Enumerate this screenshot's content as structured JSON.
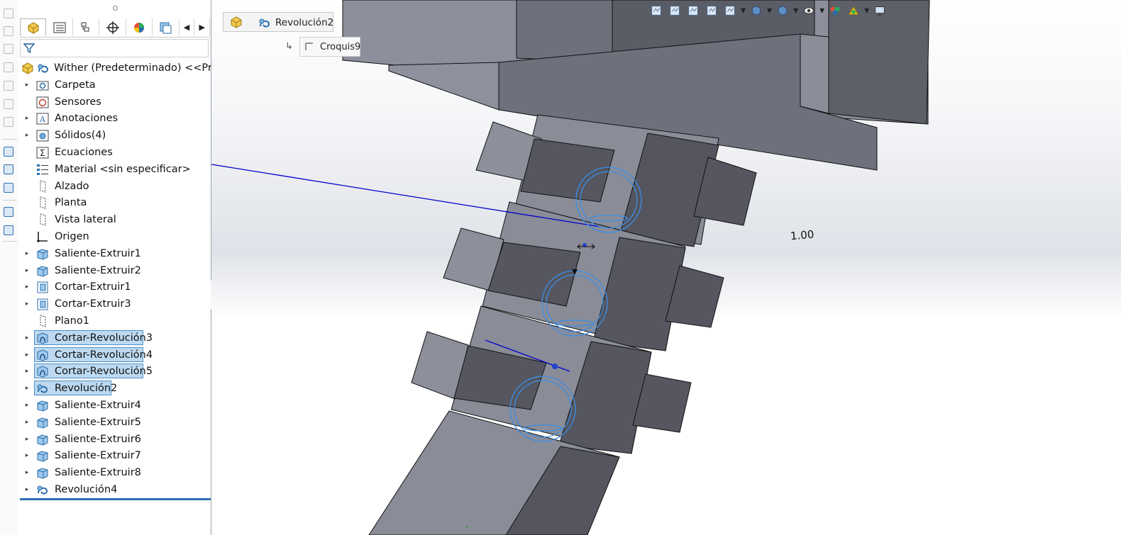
{
  "command_strip": {
    "icons": [
      "sketch-mode-icon",
      "sketch-mode-icon",
      "sketch-mode-icon",
      "sketch-mode-icon",
      "sketch-mode-icon",
      "sketch-mode-icon",
      "sketch-mode-icon",
      "smart-dimension-icon",
      "relations-icon",
      "display-icon",
      "view-settings-icon",
      "view-settings-icon"
    ]
  },
  "feature_manager": {
    "tabs": [
      "featuremanager-tab",
      "propertymanager-tab",
      "configurationmanager-tab",
      "dimxpert-tab",
      "displaymanager-tab",
      "cam-tab"
    ],
    "tree": [
      {
        "label": "Wither (Predeterminado) <<Prede",
        "icon": "part-icon",
        "expandable": false,
        "selected": false
      },
      {
        "label": "Carpeta",
        "icon": "folder-icon",
        "expandable": true,
        "selected": false
      },
      {
        "label": "Sensores",
        "icon": "sensor-icon",
        "expandable": false,
        "selected": false
      },
      {
        "label": "Anotaciones",
        "icon": "annotation-icon",
        "expandable": true,
        "selected": false
      },
      {
        "label": "Sólidos(4)",
        "icon": "solid-bodies-icon",
        "expandable": true,
        "selected": false
      },
      {
        "label": "Ecuaciones",
        "icon": "equation-icon",
        "expandable": false,
        "selected": false
      },
      {
        "label": "Material <sin especificar>",
        "icon": "material-icon",
        "expandable": false,
        "selected": false
      },
      {
        "label": "Alzado",
        "icon": "plane-icon",
        "expandable": false,
        "selected": false
      },
      {
        "label": "Planta",
        "icon": "plane-icon",
        "expandable": false,
        "selected": false
      },
      {
        "label": "Vista lateral",
        "icon": "plane-icon",
        "expandable": false,
        "selected": false
      },
      {
        "label": "Origen",
        "icon": "origin-icon",
        "expandable": false,
        "selected": false
      },
      {
        "label": "Saliente-Extruir1",
        "icon": "extrude-boss-icon",
        "expandable": true,
        "selected": false
      },
      {
        "label": "Saliente-Extruir2",
        "icon": "extrude-boss-icon",
        "expandable": true,
        "selected": false
      },
      {
        "label": "Cortar-Extruir1",
        "icon": "extrude-cut-icon",
        "expandable": true,
        "selected": false
      },
      {
        "label": "Cortar-Extruir3",
        "icon": "extrude-cut-icon",
        "expandable": true,
        "selected": false
      },
      {
        "label": "Plano1",
        "icon": "plane-icon",
        "expandable": false,
        "selected": false
      },
      {
        "label": "Cortar-Revolución3",
        "icon": "revolve-cut-icon",
        "expandable": true,
        "selected": true
      },
      {
        "label": "Cortar-Revolución4",
        "icon": "revolve-cut-icon",
        "expandable": true,
        "selected": true
      },
      {
        "label": "Cortar-Revolución5",
        "icon": "revolve-cut-icon",
        "expandable": true,
        "selected": true
      },
      {
        "label": "Revolución2",
        "icon": "revolve-icon",
        "expandable": true,
        "selected": true
      },
      {
        "label": "Saliente-Extruir4",
        "icon": "extrude-boss-icon",
        "expandable": true,
        "selected": false
      },
      {
        "label": "Saliente-Extruir5",
        "icon": "extrude-boss-icon",
        "expandable": true,
        "selected": false
      },
      {
        "label": "Saliente-Extruir6",
        "icon": "extrude-boss-icon",
        "expandable": true,
        "selected": false
      },
      {
        "label": "Saliente-Extruir7",
        "icon": "extrude-boss-icon",
        "expandable": true,
        "selected": false
      },
      {
        "label": "Saliente-Extruir8",
        "icon": "extrude-boss-icon",
        "expandable": true,
        "selected": false
      },
      {
        "label": "Revolución4",
        "icon": "revolve-icon",
        "expandable": true,
        "selected": false
      }
    ]
  },
  "breadcrumb": {
    "feature": "Revolución2",
    "sketch": "Croquis9"
  },
  "heads_up_toolbar": {
    "icons": [
      "zoom-to-fit-icon",
      "zoom-to-area-icon",
      "previous-view-icon",
      "section-view-icon",
      "dynamic-annotation-icon",
      "view-orientation-icon",
      "display-style-icon",
      "hide-show-icon",
      "edit-appearance-icon",
      "apply-scene-icon",
      "view-settings-icon"
    ]
  },
  "viewport": {
    "dimension_value": "1.00",
    "colors": {
      "face_light": "#8a8c99",
      "face_mid": "#6f717e",
      "face_dark": "#55565f",
      "sketch_blue": "#0000cc",
      "circle_blue": "#3b8fe8"
    }
  }
}
